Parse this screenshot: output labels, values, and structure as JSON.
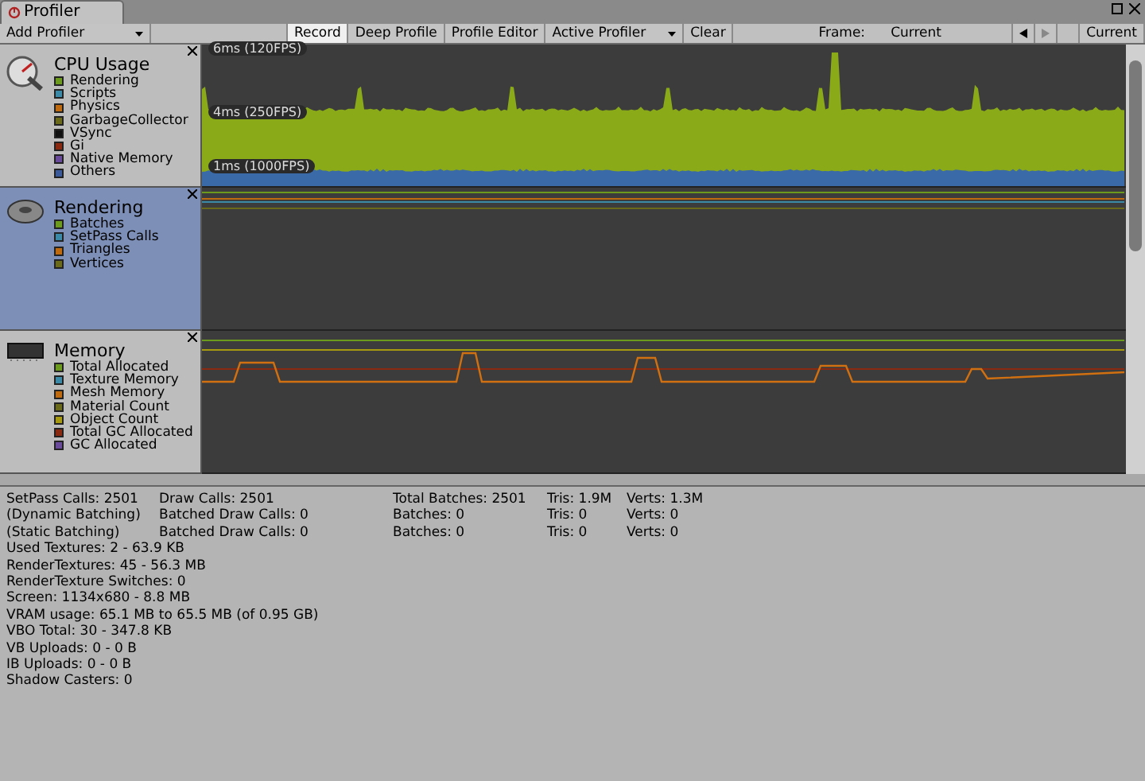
{
  "window": {
    "tab_title": "Profiler"
  },
  "toolbar": {
    "add_profiler": "Add Profiler",
    "buttons": [
      {
        "label": "Record",
        "selected": true,
        "dropdown": false
      },
      {
        "label": "Deep Profile",
        "selected": false,
        "dropdown": false
      },
      {
        "label": "Profile Editor",
        "selected": false,
        "dropdown": false
      },
      {
        "label": "Active Profiler",
        "selected": false,
        "dropdown": true
      },
      {
        "label": "Clear",
        "selected": false,
        "dropdown": false
      }
    ],
    "frame_label": "Frame:",
    "frame_value": "Current",
    "current_button": "Current"
  },
  "modules": [
    {
      "kind": "cpu",
      "title": "CPU Usage",
      "selected": false,
      "legend": [
        {
          "label": "Rendering",
          "color": "#6b9a1c"
        },
        {
          "label": "Scripts",
          "color": "#3a8aa8"
        },
        {
          "label": "Physics",
          "color": "#c06a10"
        },
        {
          "label": "GarbageCollector",
          "color": "#6b6a1a"
        },
        {
          "label": "VSync",
          "color": "#101010"
        },
        {
          "label": "Gi",
          "color": "#8a2a10"
        },
        {
          "label": "Native Memory",
          "color": "#6a4a9a"
        },
        {
          "label": "Others",
          "color": "#3a5a9a"
        }
      ],
      "chart_labels": [
        "6ms (120FPS)",
        "4ms (250FPS)",
        "1ms (1000FPS)"
      ]
    },
    {
      "kind": "rendering",
      "title": "Rendering",
      "selected": true,
      "legend": [
        {
          "label": "Batches",
          "color": "#6b9a1c"
        },
        {
          "label": "SetPass Calls",
          "color": "#3a8aa8"
        },
        {
          "label": "Triangles",
          "color": "#c06a10"
        },
        {
          "label": "Vertices",
          "color": "#6b6a1a"
        }
      ]
    },
    {
      "kind": "memory",
      "title": "Memory",
      "selected": false,
      "legend": [
        {
          "label": "Total Allocated",
          "color": "#6b9a1c"
        },
        {
          "label": "Texture Memory",
          "color": "#3a8aa8"
        },
        {
          "label": "Mesh Memory",
          "color": "#c06a10"
        },
        {
          "label": "Material Count",
          "color": "#6b6a1a"
        },
        {
          "label": "Object Count",
          "color": "#a89a10"
        },
        {
          "label": "Total GC Allocated",
          "color": "#8a2a10"
        },
        {
          "label": "GC Allocated",
          "color": "#6a4a9a"
        }
      ]
    }
  ],
  "stats": {
    "table": [
      [
        "SetPass Calls: 2501",
        "Draw Calls: 2501",
        "Total Batches: 2501",
        "Tris: 1.9M",
        "Verts: 1.3M"
      ],
      [
        "(Dynamic Batching)",
        "Batched Draw Calls: 0",
        "Batches: 0",
        "Tris: 0",
        "Verts: 0"
      ],
      [
        "(Static Batching)",
        "Batched Draw Calls: 0",
        "Batches: 0",
        "Tris: 0",
        "Verts: 0"
      ]
    ],
    "lines": [
      "Used Textures: 2 - 63.9 KB",
      "RenderTextures: 45 - 56.3 MB",
      "RenderTexture Switches: 0",
      "Screen: 1134x680 - 8.8 MB",
      "VRAM usage: 65.1 MB to 65.5 MB (of 0.95 GB)",
      "VBO Total: 30 - 347.8 KB",
      "VB Uploads: 0 - 0 B",
      "IB Uploads: 0 - 0 B",
      "Shadow Casters: 0"
    ]
  }
}
